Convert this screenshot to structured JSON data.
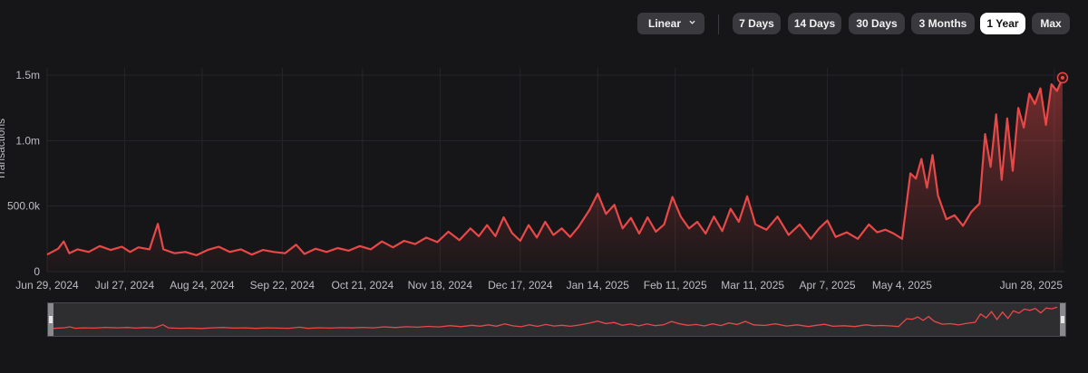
{
  "toolbar": {
    "scale_label": "Linear",
    "ranges": [
      "7 Days",
      "14 Days",
      "30 Days",
      "3 Months",
      "1 Year",
      "Max"
    ],
    "active_range": "1 Year"
  },
  "colors": {
    "background": "#161618",
    "line": "#e84848",
    "grid": "#26262a",
    "axis_text": "#bdbdc2"
  },
  "chart_data": {
    "type": "area",
    "title": "",
    "xlabel": "",
    "ylabel": "Transactions",
    "ylim": [
      0,
      1500000
    ],
    "y_ticks": [
      {
        "value": 0,
        "label": "0"
      },
      {
        "value": 500000,
        "label": "500.0k"
      },
      {
        "value": 1000000,
        "label": "1.0m"
      },
      {
        "value": 1500000,
        "label": "1.5m"
      }
    ],
    "x_range": [
      "2024-06-29",
      "2025-07-02"
    ],
    "x_tick_labels": [
      "Jun 29, 2024",
      "Jul 27, 2024",
      "Aug 24, 2024",
      "Sep 22, 2024",
      "Oct 21, 2024",
      "Nov 18, 2024",
      "Dec 17, 2024",
      "Jan 14, 2025",
      "Feb 11, 2025",
      "Mar 11, 2025",
      "Apr 7, 2025",
      "May 4, 2025",
      "Jun 28, 2025"
    ],
    "x_tick_dates": [
      "2024-06-29",
      "2024-07-27",
      "2024-08-24",
      "2024-09-22",
      "2024-10-21",
      "2024-11-18",
      "2024-12-17",
      "2025-01-14",
      "2025-02-11",
      "2025-03-11",
      "2025-04-07",
      "2025-05-04",
      "2025-06-28"
    ],
    "grid": true,
    "legend": "none",
    "series": [
      {
        "points": [
          [
            "2024-06-29",
            130000
          ],
          [
            "2024-07-03",
            175000
          ],
          [
            "2024-07-05",
            230000
          ],
          [
            "2024-07-07",
            140000
          ],
          [
            "2024-07-10",
            170000
          ],
          [
            "2024-07-14",
            150000
          ],
          [
            "2024-07-18",
            195000
          ],
          [
            "2024-07-22",
            165000
          ],
          [
            "2024-07-26",
            190000
          ],
          [
            "2024-07-29",
            150000
          ],
          [
            "2024-08-01",
            185000
          ],
          [
            "2024-08-05",
            170000
          ],
          [
            "2024-08-08",
            365000
          ],
          [
            "2024-08-10",
            170000
          ],
          [
            "2024-08-14",
            140000
          ],
          [
            "2024-08-18",
            150000
          ],
          [
            "2024-08-22",
            125000
          ],
          [
            "2024-08-26",
            165000
          ],
          [
            "2024-08-30",
            190000
          ],
          [
            "2024-09-03",
            150000
          ],
          [
            "2024-09-07",
            170000
          ],
          [
            "2024-09-11",
            130000
          ],
          [
            "2024-09-15",
            165000
          ],
          [
            "2024-09-19",
            150000
          ],
          [
            "2024-09-23",
            140000
          ],
          [
            "2024-09-27",
            205000
          ],
          [
            "2024-09-30",
            135000
          ],
          [
            "2024-10-04",
            175000
          ],
          [
            "2024-10-08",
            150000
          ],
          [
            "2024-10-12",
            180000
          ],
          [
            "2024-10-16",
            160000
          ],
          [
            "2024-10-20",
            195000
          ],
          [
            "2024-10-24",
            170000
          ],
          [
            "2024-10-28",
            230000
          ],
          [
            "2024-11-01",
            185000
          ],
          [
            "2024-11-05",
            235000
          ],
          [
            "2024-11-09",
            210000
          ],
          [
            "2024-11-13",
            260000
          ],
          [
            "2024-11-17",
            225000
          ],
          [
            "2024-11-21",
            305000
          ],
          [
            "2024-11-25",
            240000
          ],
          [
            "2024-11-29",
            330000
          ],
          [
            "2024-12-02",
            270000
          ],
          [
            "2024-12-05",
            355000
          ],
          [
            "2024-12-08",
            270000
          ],
          [
            "2024-12-11",
            415000
          ],
          [
            "2024-12-14",
            295000
          ],
          [
            "2024-12-17",
            235000
          ],
          [
            "2024-12-20",
            355000
          ],
          [
            "2024-12-23",
            260000
          ],
          [
            "2024-12-26",
            380000
          ],
          [
            "2024-12-29",
            280000
          ],
          [
            "2025-01-01",
            330000
          ],
          [
            "2025-01-04",
            265000
          ],
          [
            "2025-01-07",
            340000
          ],
          [
            "2025-01-11",
            470000
          ],
          [
            "2025-01-14",
            595000
          ],
          [
            "2025-01-17",
            440000
          ],
          [
            "2025-01-20",
            510000
          ],
          [
            "2025-01-23",
            330000
          ],
          [
            "2025-01-26",
            410000
          ],
          [
            "2025-01-29",
            290000
          ],
          [
            "2025-02-01",
            415000
          ],
          [
            "2025-02-04",
            305000
          ],
          [
            "2025-02-07",
            360000
          ],
          [
            "2025-02-10",
            570000
          ],
          [
            "2025-02-13",
            420000
          ],
          [
            "2025-02-16",
            330000
          ],
          [
            "2025-02-19",
            380000
          ],
          [
            "2025-02-22",
            290000
          ],
          [
            "2025-02-25",
            420000
          ],
          [
            "2025-02-28",
            310000
          ],
          [
            "2025-03-03",
            480000
          ],
          [
            "2025-03-06",
            380000
          ],
          [
            "2025-03-09",
            575000
          ],
          [
            "2025-03-12",
            360000
          ],
          [
            "2025-03-16",
            320000
          ],
          [
            "2025-03-20",
            420000
          ],
          [
            "2025-03-24",
            280000
          ],
          [
            "2025-03-28",
            360000
          ],
          [
            "2025-04-01",
            250000
          ],
          [
            "2025-04-04",
            330000
          ],
          [
            "2025-04-07",
            390000
          ],
          [
            "2025-04-10",
            265000
          ],
          [
            "2025-04-14",
            300000
          ],
          [
            "2025-04-18",
            250000
          ],
          [
            "2025-04-22",
            360000
          ],
          [
            "2025-04-25",
            300000
          ],
          [
            "2025-04-28",
            320000
          ],
          [
            "2025-05-01",
            290000
          ],
          [
            "2025-05-04",
            250000
          ],
          [
            "2025-05-07",
            750000
          ],
          [
            "2025-05-09",
            710000
          ],
          [
            "2025-05-11",
            860000
          ],
          [
            "2025-05-13",
            640000
          ],
          [
            "2025-05-15",
            890000
          ],
          [
            "2025-05-17",
            580000
          ],
          [
            "2025-05-20",
            400000
          ],
          [
            "2025-05-23",
            430000
          ],
          [
            "2025-05-26",
            350000
          ],
          [
            "2025-05-29",
            455000
          ],
          [
            "2025-06-01",
            520000
          ],
          [
            "2025-06-03",
            1050000
          ],
          [
            "2025-06-05",
            800000
          ],
          [
            "2025-06-07",
            1200000
          ],
          [
            "2025-06-09",
            700000
          ],
          [
            "2025-06-11",
            1170000
          ],
          [
            "2025-06-13",
            770000
          ],
          [
            "2025-06-15",
            1250000
          ],
          [
            "2025-06-17",
            1100000
          ],
          [
            "2025-06-19",
            1360000
          ],
          [
            "2025-06-21",
            1280000
          ],
          [
            "2025-06-23",
            1400000
          ],
          [
            "2025-06-25",
            1120000
          ],
          [
            "2025-06-27",
            1430000
          ],
          [
            "2025-06-29",
            1380000
          ],
          [
            "2025-07-01",
            1480000
          ]
        ]
      }
    ]
  }
}
